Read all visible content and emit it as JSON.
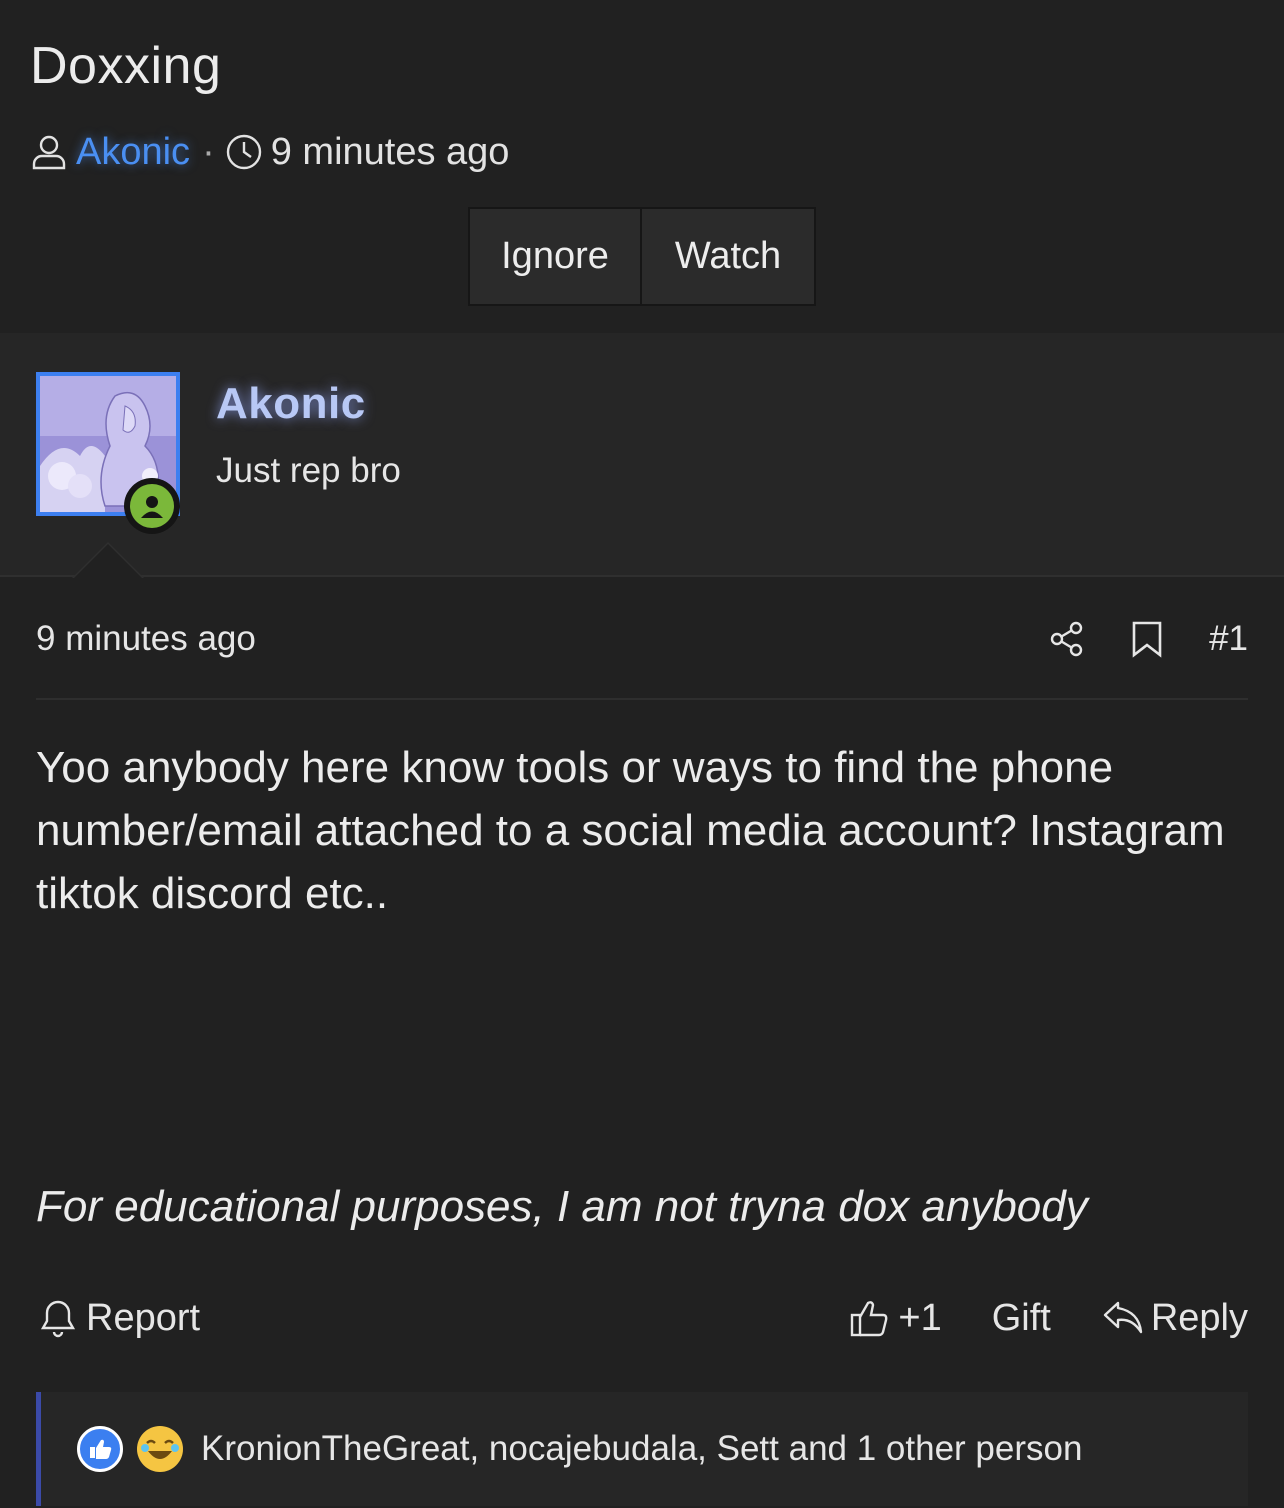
{
  "thread": {
    "title": "Doxxing",
    "author": "Akonic",
    "time": "9 minutes ago",
    "buttons": {
      "ignore": "Ignore",
      "watch": "Watch"
    },
    "icons": [
      "user-icon",
      "clock-icon"
    ]
  },
  "post": {
    "user": {
      "name": "Akonic",
      "title": "Just rep bro",
      "online": true
    },
    "time": "9 minutes ago",
    "number": "#1",
    "body": "Yoo anybody here know tools or ways to find the phone number/email attached to a social media account? Instagram tiktok discord etc..",
    "italic": "For educational purposes, I am not tryna dox anybody",
    "actions": {
      "report": "Report",
      "like": "+1",
      "gift": "Gift",
      "reply": "Reply"
    },
    "reactions_text": "KronionTheGreat, nocajebudala, Sett and 1 other person"
  },
  "colors": {
    "background": "#212121",
    "user_block": "#262626",
    "link": "#4a8ff2",
    "username_glow": "#b8c8f5",
    "online": "#7bb83a",
    "reaction_bar": "#3b4aa8"
  }
}
